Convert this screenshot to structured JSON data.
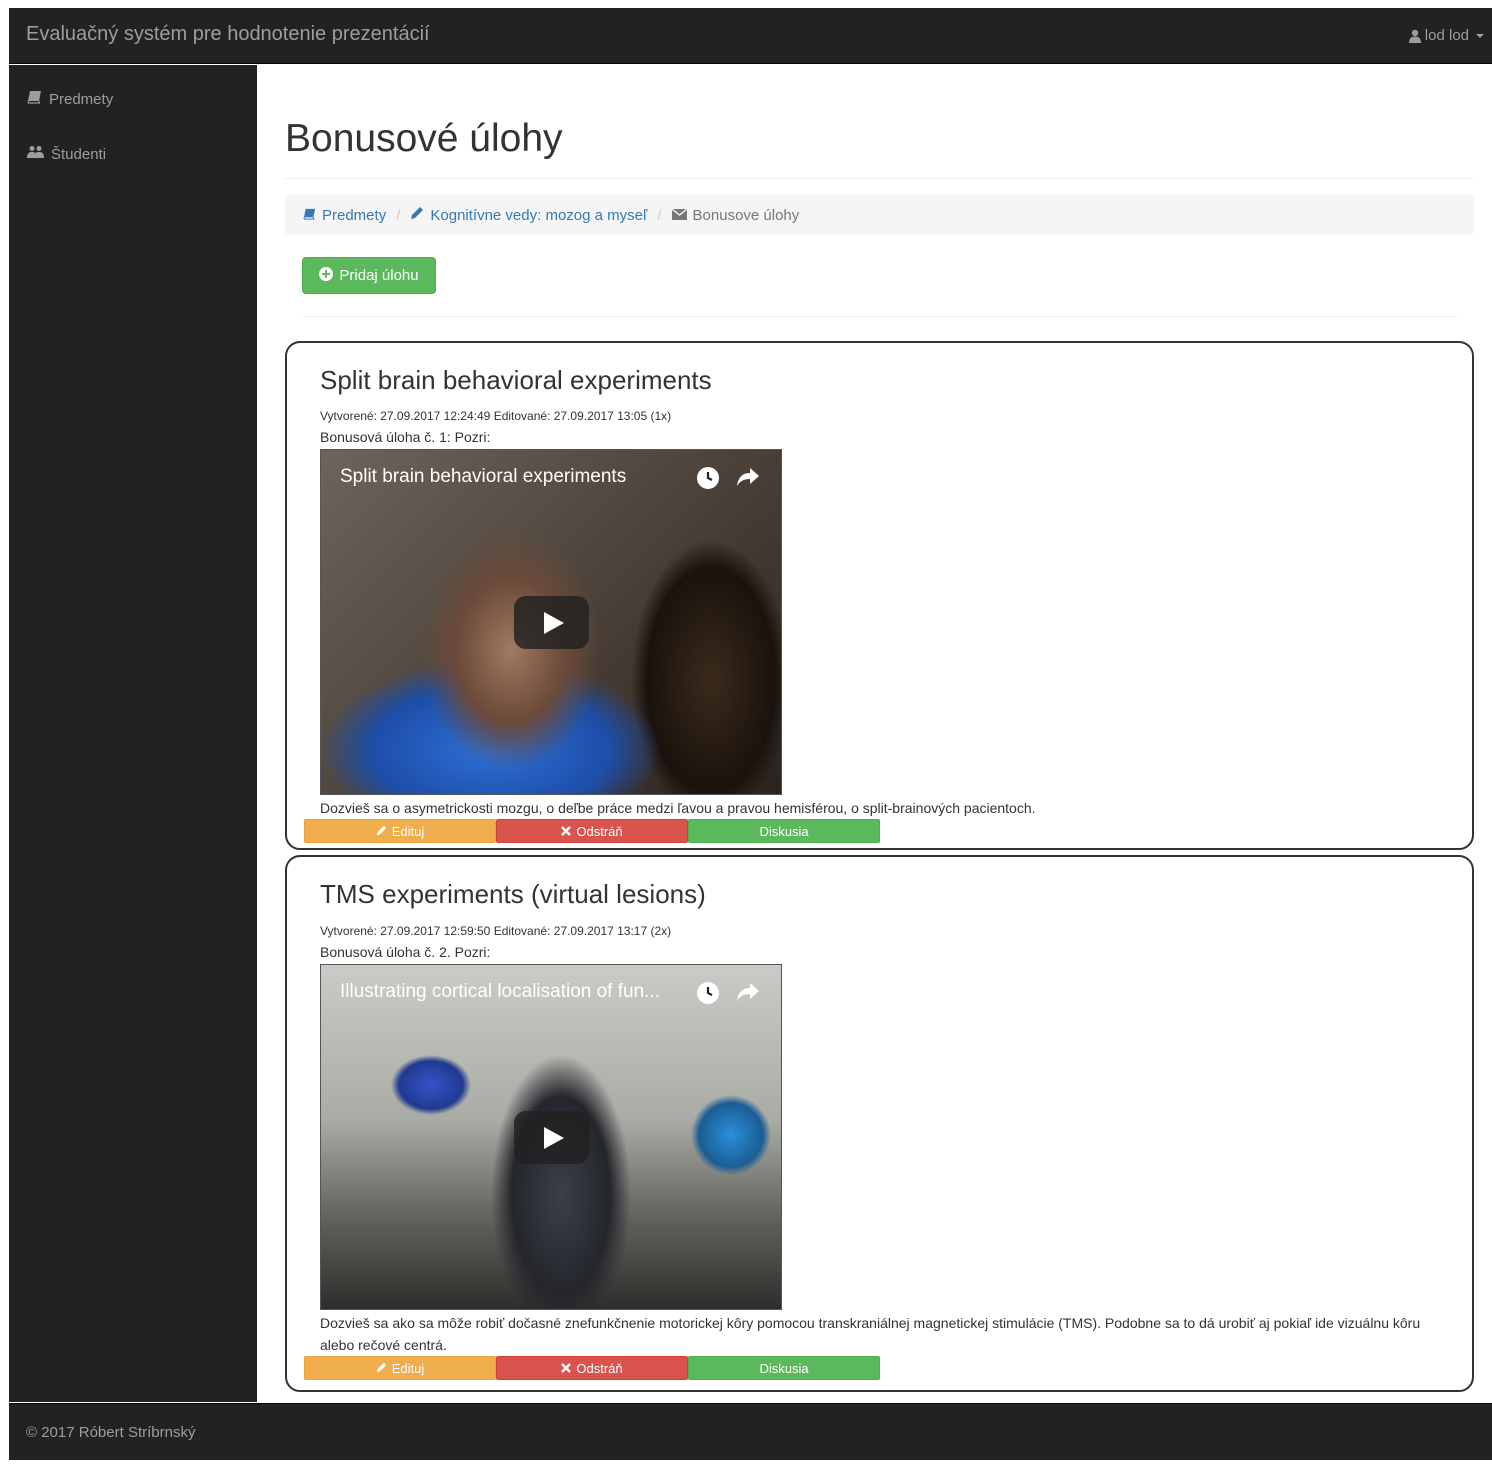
{
  "navbar": {
    "brand": "Evaluačný systém pre hodnotenie prezentácií",
    "user_label": "lod lod"
  },
  "sidebar": {
    "items": [
      {
        "label": "Predmety",
        "icon": "book-icon"
      },
      {
        "label": "Študenti",
        "icon": "users-icon"
      }
    ]
  },
  "main": {
    "page_title": "Bonusové úlohy",
    "breadcrumb": [
      {
        "label": "Predmety",
        "icon": "book-icon"
      },
      {
        "label": "Kognitívne vedy: mozog a myseľ",
        "icon": "pencil-icon"
      },
      {
        "label": "Bonusove úlohy",
        "icon": "envelope-icon"
      }
    ],
    "add_button_label": "Pridaj úlohu"
  },
  "tasks": [
    {
      "title": "Split brain behavioral experiments",
      "meta": "Vytvorené: 27.09.2017 12:24:49 Editované: 27.09.2017 13:05 (1x)",
      "intro": "Bonusová úloha č. 1: Pozri:",
      "video_title": "Split brain behavioral experiments",
      "description": "Dozvieš sa o asymetrickosti mozgu, o deľbe práce medzi ľavou a pravou hemisférou, o split-brainových pacientoch.",
      "actions": {
        "edit": "Edituj",
        "delete": "Odstráň",
        "discuss": "Diskusia"
      }
    },
    {
      "title": "TMS experiments (virtual lesions)",
      "meta": "Vytvorené: 27.09.2017 12:59:50 Editované: 27.09.2017 13:17 (2x)",
      "intro": "Bonusová úloha č. 2. Pozri:",
      "video_title": "Illustrating cortical localisation of fun...",
      "description": "Dozvieš sa ako sa môže robiť dočasné znefunkčnenie motorickej kôry pomocou transkraniálnej magnetickej stimulácie (TMS). Podobne sa to dá urobiť aj pokiaľ ide vizuálnu kôru alebo rečové centrá.",
      "actions": {
        "edit": "Edituj",
        "delete": "Odstráň",
        "discuss": "Diskusia"
      }
    }
  ],
  "footer": {
    "text": "© 2017 Róbert Stríbrnský"
  },
  "colors": {
    "navbar_bg": "#222222",
    "link": "#337ab7",
    "success": "#5cb85c",
    "warning": "#f0ad4e",
    "danger": "#d9534f"
  }
}
